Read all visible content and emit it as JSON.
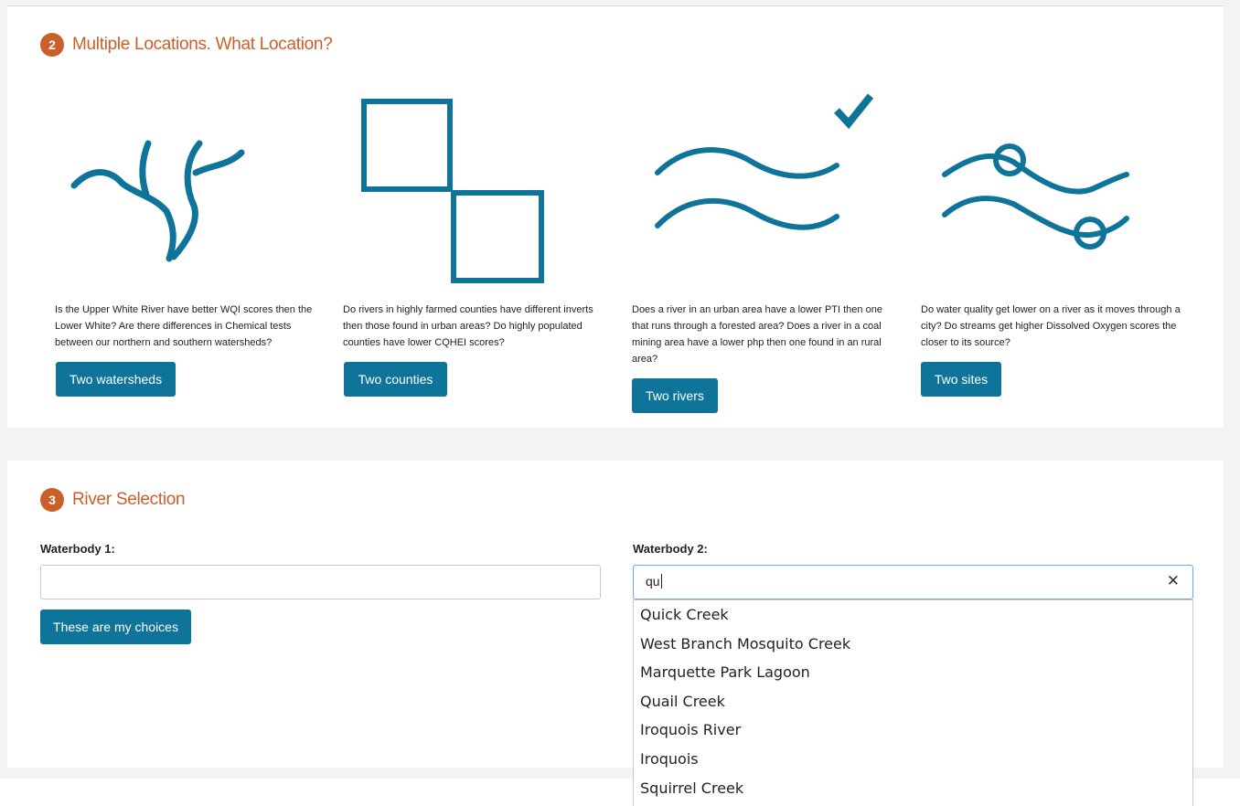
{
  "section_locations": {
    "step_number": "2",
    "title": "Multiple Locations. What Location?",
    "options": [
      {
        "icon": "watershed-branch-icon",
        "description": "Is the Upper White River have better WQI scores then the Lower White? Are there differences in Chemical tests between our northern and southern watersheds?",
        "button_label": "Two watersheds",
        "selected": false
      },
      {
        "icon": "two-squares-icon",
        "description": "Do rivers in highly farmed counties have different inverts then those found in urban areas? Do highly populated counties have lower CQHEI scores?",
        "button_label": "Two counties",
        "selected": false
      },
      {
        "icon": "two-waves-icon",
        "description": "Does a river in an urban area have a lower PTI then one that runs through a forested area? Does a river in a coal mining area have a lower php then one found in an rural area?",
        "button_label": "Two rivers",
        "selected": true
      },
      {
        "icon": "waves-with-sites-icon",
        "description": "Do water quality get lower on a river as it moves through a city? Do streams get higher Dissolved Oxygen scores the closer to its source?",
        "button_label": "Two sites",
        "selected": false
      }
    ]
  },
  "section_river": {
    "step_number": "3",
    "title": "River Selection",
    "waterbody1": {
      "label": "Waterbody 1:",
      "value": ""
    },
    "waterbody2": {
      "label": "Waterbody 2:",
      "value": "qu"
    },
    "submit_label": "These are my choices",
    "suggestions": [
      "Quick Creek",
      "West Branch Mosquito Creek",
      "Marquette Park Lagoon",
      "Quail Creek",
      "Iroquois River",
      "Iroquois",
      "Squirrel Creek"
    ]
  },
  "colors": {
    "accent": "#c9602a",
    "primary": "#0f7499",
    "icon_stroke": "#0f7499"
  }
}
